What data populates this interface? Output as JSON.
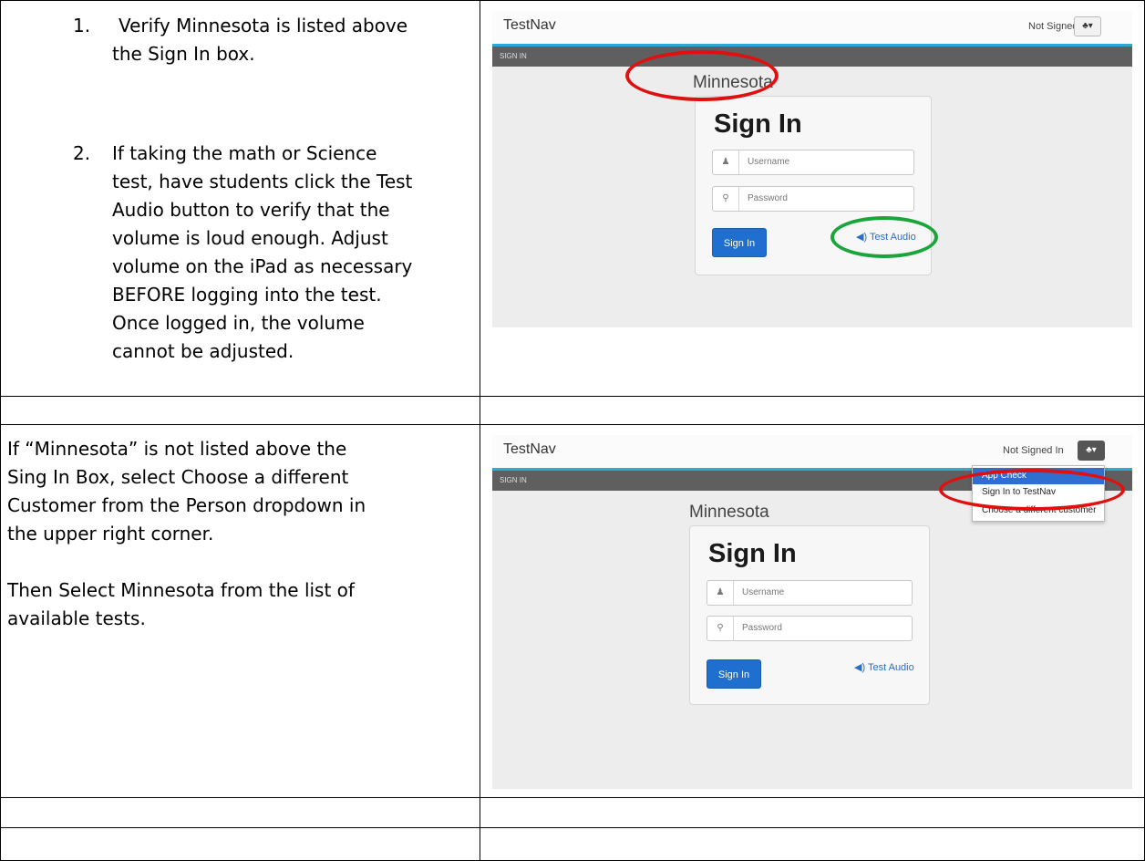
{
  "row1": {
    "steps": [
      {
        "number": "1.",
        "lines": [
          "Verify Minnesota is listed above",
          "the Sign In box."
        ]
      },
      {
        "number": "2.",
        "lines": [
          "If taking the math or Science",
          "test, have students click the Test",
          "Audio button to verify that the",
          "volume is loud enough.  Adjust",
          "volume on the iPad as necessary",
          "BEFORE logging into the test.",
          "Once logged in, the volume",
          "cannot be adjusted."
        ]
      }
    ]
  },
  "row3": {
    "paragraph1": [
      "If “Minnesota” is not listed above the",
      "Sing In Box, select Choose a different",
      "Customer from the Person dropdown in",
      "the upper right corner."
    ],
    "paragraph2": [
      "Then Select Minnesota from the list of",
      "available tests."
    ]
  },
  "screen": {
    "brand": "TestNav",
    "status": "Not Signed In",
    "user_button": "♣▾",
    "nav_label": "SIGN IN",
    "state": "Minnesota",
    "heading": "Sign In",
    "username_placeholder": "Username",
    "password_placeholder": "Password",
    "signin_button": "Sign In",
    "audio": "◀) Test Audio",
    "menu": [
      "App Check",
      "Sign In to TestNav",
      "Choose a different customer"
    ]
  },
  "colors": {
    "highlight_red": "#e01010",
    "highlight_green": "#1aa53a",
    "accent_blue": "#1e6fd0"
  }
}
